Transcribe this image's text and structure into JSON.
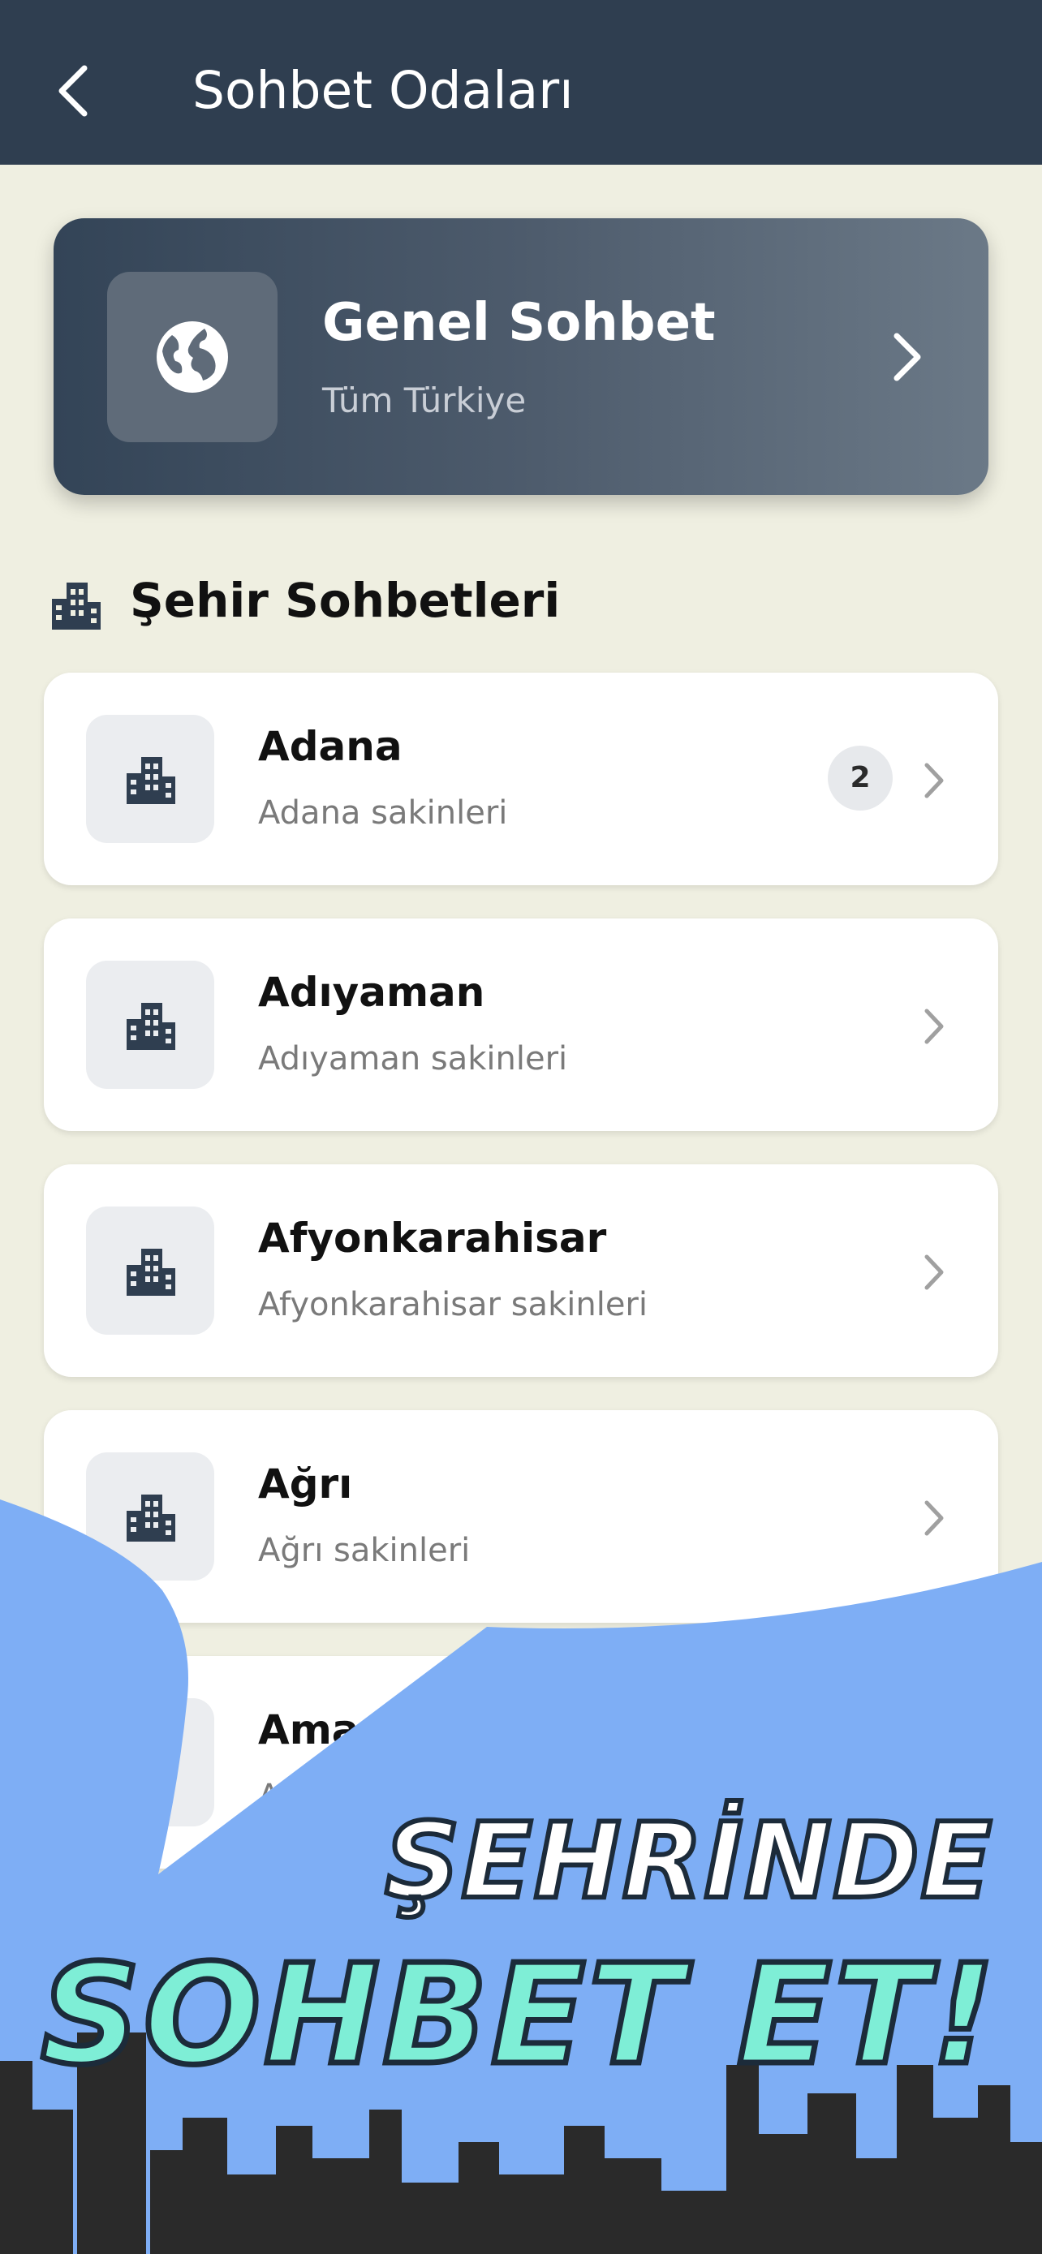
{
  "header": {
    "title": "Sohbet Odaları"
  },
  "general": {
    "title": "Genel Sohbet",
    "subtitle": "Tüm Türkiye"
  },
  "section": {
    "title": "Şehir Sohbetleri"
  },
  "cities": [
    {
      "name": "Adana",
      "subtitle": "Adana sakinleri",
      "badge": "2"
    },
    {
      "name": "Adıyaman",
      "subtitle": "Adıyaman sakinleri"
    },
    {
      "name": "Afyonkarahisar",
      "subtitle": "Afyonkarahisar sakinleri"
    },
    {
      "name": "Ağrı",
      "subtitle": "Ağrı sakinleri"
    },
    {
      "name": "Amasya",
      "subtitle": "Amasya sakinleri"
    }
  ],
  "promo": {
    "line1": "ŞEHRİNDE",
    "line2": "SOHBET ET!"
  },
  "colors": {
    "header": "#2f3e50",
    "background": "#efefe1",
    "promo_sky": "#7eaef5",
    "promo_text": "#7eeed6",
    "skyline": "#2a2a2a"
  },
  "icons": {
    "back": "chevron-left-icon",
    "globe": "globe-icon",
    "city": "city-icon",
    "chevron": "chevron-right-icon"
  }
}
